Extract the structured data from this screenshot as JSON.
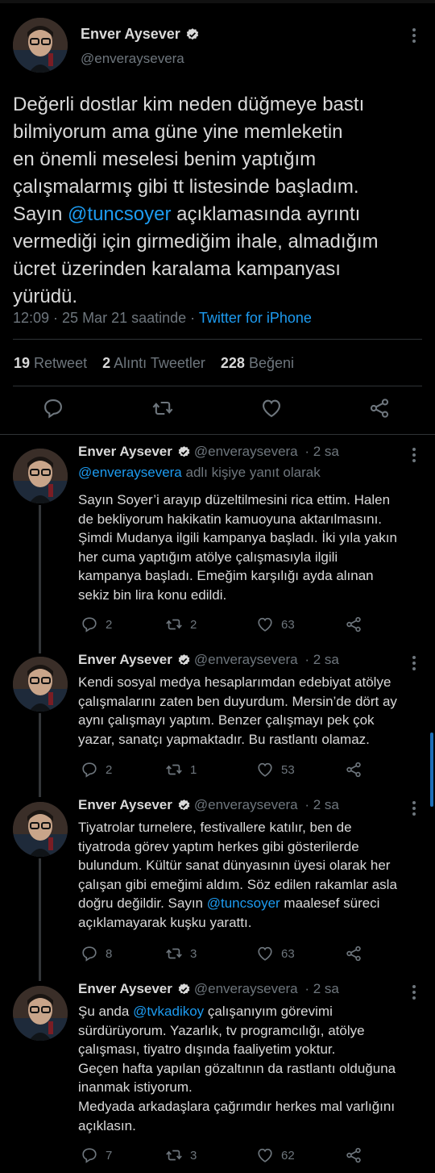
{
  "main_tweet": {
    "display_name": "Enver Aysever",
    "handle": "@enveraysevera",
    "text_before_mention": "Değerli dostlar kim neden düğmeye bastı\nbilmiyorum ama güne yine memleketin\nen önemli meselesi benim yaptığım\nçalışmalarmış gibi tt listesinde başladım.\nSayın ",
    "mention": "@tuncsoyer",
    "text_after_mention": " açıklamasında ayrıntı\nvermediği için girmediğim ihale, almadığım\nücret üzerinden karalama kampanyası\nyürüdü.",
    "timestamp": "12:09 · 25 Mar 21 saatinde · ",
    "source": "Twitter for iPhone",
    "stats": {
      "retweets_count": "19",
      "retweets_label": "Retweet",
      "quotes_count": "2",
      "quotes_label": "Alıntı Tweetler",
      "likes_count": "228",
      "likes_label": "Beğeni"
    },
    "actions": [
      "reply-icon",
      "retweet-icon",
      "like-icon",
      "share-icon"
    ]
  },
  "replies": [
    {
      "display_name": "Enver Aysever",
      "handle": "@enveraysevera",
      "time": "· 2 sa",
      "reply_to_mention": "@enveraysevera",
      "reply_to_suffix": " adlı kişiye yanıt olarak",
      "text": "Sayın Soyer’i arayıp düzeltilmesini rica ettim. Halen\nde bekliyorum hakikatin kamuoyuna aktarılmasını.\nŞimdi Mudanya ilgili kampanya başladı. İki yıla yakın\nher cuma yaptığım atölye çalışmasıyla ilgili\nkampanya başladı. Emeğim karşılığı ayda alınan\nsekiz bin lira konu edildi.",
      "replies": "2",
      "retweets": "2",
      "likes": "63"
    },
    {
      "display_name": "Enver Aysever",
      "handle": "@enveraysevera",
      "time": "· 2 sa",
      "text": "Kendi sosyal medya hesaplarımdan edebiyat atölye\nçalışmalarını zaten ben duyurdum. Mersin’de dört ay\naynı çalışmayı yaptım. Benzer çalışmayı pek çok\nyazar, sanatçı yapmaktadır. Bu rastlantı olamaz.",
      "replies": "2",
      "retweets": "1",
      "likes": "53"
    },
    {
      "display_name": "Enver Aysever",
      "handle": "@enveraysevera",
      "time": "· 2 sa",
      "text_before_mention": "Tiyatrolar turnelere, festivallere katılır, ben de\ntiyatroda görev yaptım herkes gibi gösterilerde\nbulundum. Kültür sanat dünyasının üyesi olarak her\nçalışan gibi emeğimi aldım. Söz edilen rakamlar asla\ndoğru değildir. Sayın ",
      "mention": "@tuncsoyer",
      "text_after_mention": " maalesef süreci\naçıklamayarak kuşku yarattı.",
      "replies": "8",
      "retweets": "3",
      "likes": "63"
    },
    {
      "display_name": "Enver Aysever",
      "handle": "@enveraysevera",
      "time": "· 2 sa",
      "text_before_mention": "Şu anda ",
      "mention": "@tvkadikoy",
      "text_after_mention": " çalışanıyım görevimi\nsürdürüyorum. Yazarlık, tv programcılığı, atölye\nçalışması, tiyatro dışında faaliyetim yoktur.\nGeçen hafta yapılan gözaltının da rastlantı olduğuna\ninanmak istiyorum.\nMedyada arkadaşlara çağrımdır herkes mal varlığını\naçıklasın.",
      "replies": "7",
      "retweets": "3",
      "likes": "62"
    }
  ],
  "colors": {
    "background": "#000000",
    "text": "#d9d9d9",
    "secondary": "#6e767d",
    "link": "#1d9bf0",
    "divider": "#2f3336"
  }
}
